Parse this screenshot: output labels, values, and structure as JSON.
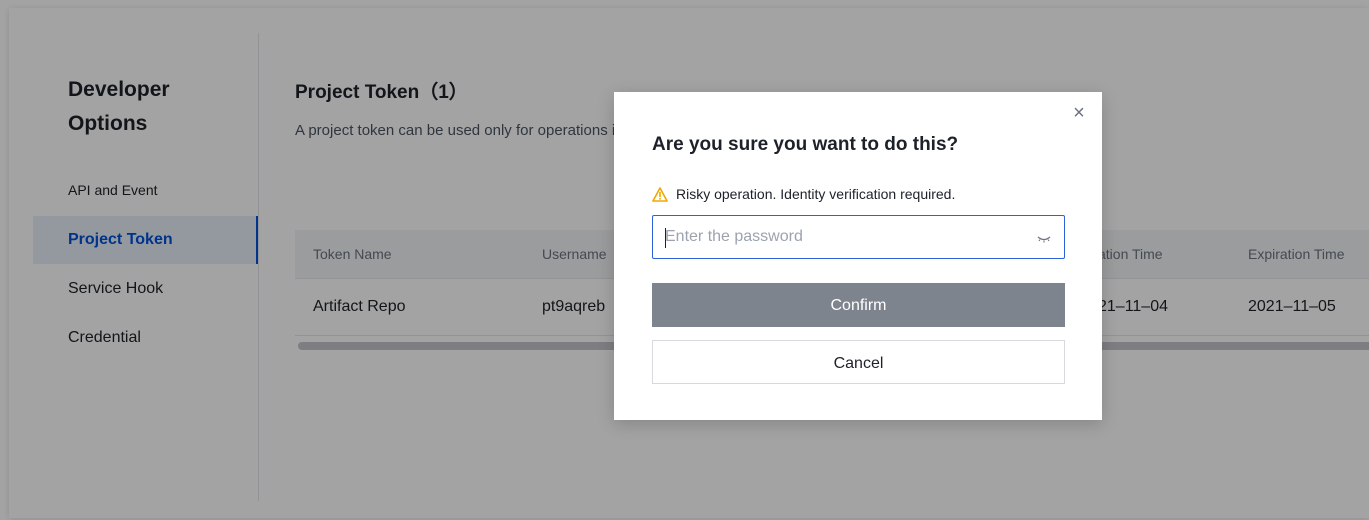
{
  "sidebar": {
    "title": "Developer Options",
    "items": [
      {
        "label": "API and Event"
      },
      {
        "label": "Project Token"
      },
      {
        "label": "Service Hook"
      },
      {
        "label": "Credential"
      }
    ]
  },
  "main": {
    "title": "Project Token（1）",
    "description": "A project token can be used only for operations in the project and cannot be used as a personal access token",
    "table": {
      "columns": [
        "Token Name",
        "Username",
        "",
        "",
        "",
        "ation Time",
        "Expiration Time"
      ],
      "rows": [
        [
          "Artifact Repo",
          "pt9aqreb",
          "",
          "",
          "",
          "21–11–04",
          "2021–11–05"
        ]
      ]
    }
  },
  "dialog": {
    "title": "Are you sure you want to do this?",
    "warning": "Risky operation. Identity verification required.",
    "password_placeholder": "Enter the password",
    "password_value": "",
    "confirm_label": "Confirm",
    "cancel_label": "Cancel"
  },
  "colors": {
    "accent": "#0052d9",
    "warning": "#f0a800",
    "confirm_bg": "#7d848d"
  }
}
